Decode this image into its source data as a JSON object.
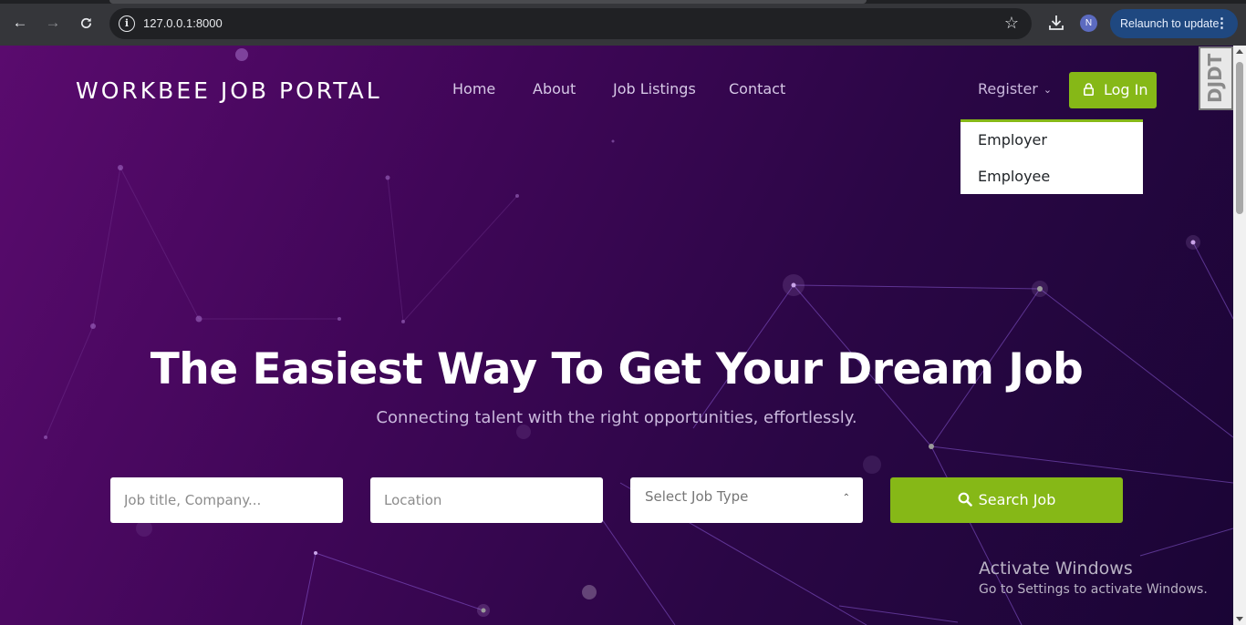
{
  "browser": {
    "url": "127.0.0.1:8000",
    "profile_initial": "N",
    "relaunch_label": "Relaunch to update",
    "icons": [
      "back-icon",
      "forward-icon",
      "reload-icon",
      "info-icon",
      "star-icon",
      "download-icon",
      "more-icon"
    ]
  },
  "nav": {
    "brand": "WORKBEE JOB PORTAL",
    "links": [
      "Home",
      "About",
      "Job Listings",
      "Contact"
    ],
    "register_label": "Register",
    "login_label": "Log In",
    "dropdown": [
      "Employer",
      "Employee"
    ],
    "debug_toolbar_label": "DJDT"
  },
  "hero": {
    "title": "The Easiest Way To Get Your Dream Job",
    "subtitle": "Connecting talent with the right opportunities, effortlessly."
  },
  "search": {
    "keyword_placeholder": "Job title, Company...",
    "location_placeholder": "Location",
    "job_type_label": "Select Job Type",
    "button_label": "Search Job"
  },
  "windows_watermark": {
    "title": "Activate Windows",
    "subtitle": "Go to Settings to activate Windows."
  },
  "colors": {
    "accent_green": "#86b817",
    "hero_purple": "#3f0657",
    "chrome_bg": "#35363a",
    "relaunch_blue": "#1f4880"
  }
}
